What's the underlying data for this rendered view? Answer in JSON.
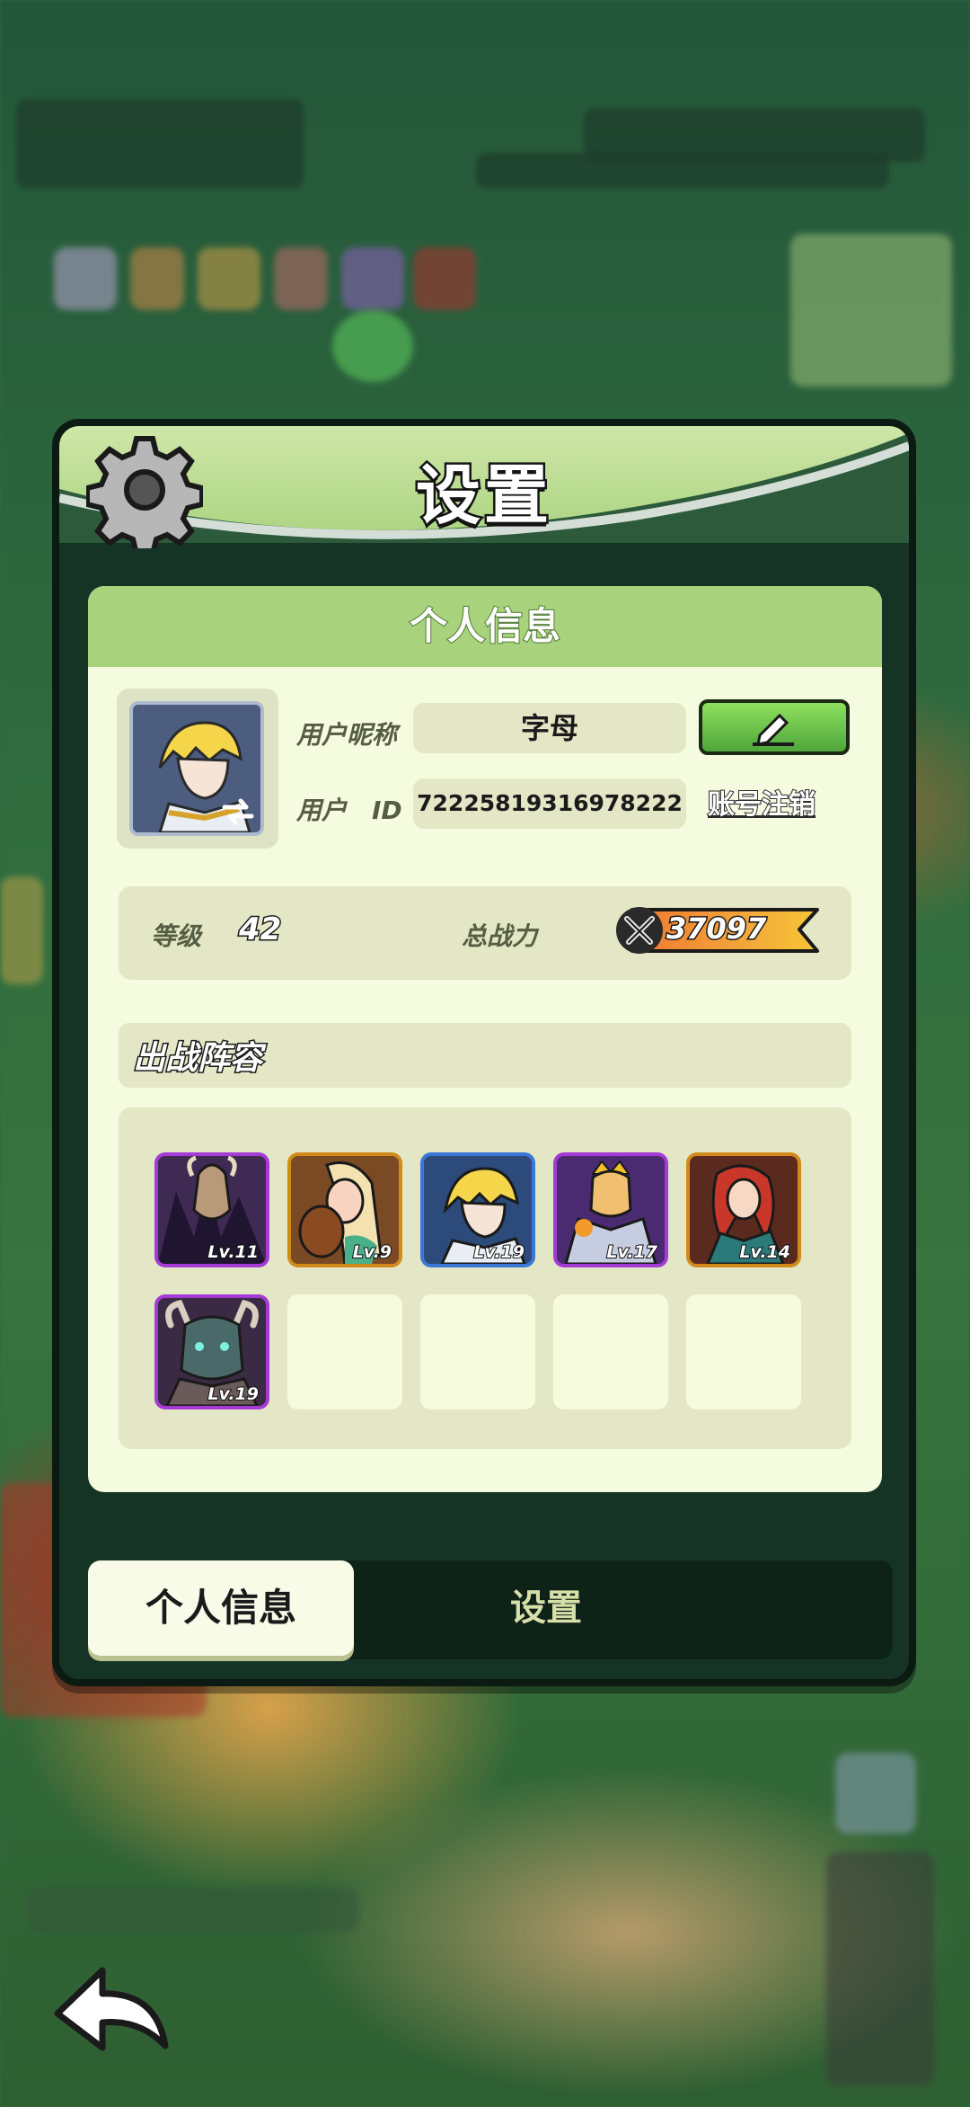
{
  "dialog": {
    "title": "设置",
    "card_title": "个人信息"
  },
  "profile": {
    "nickname_label": "用户昵称",
    "nickname": "字母",
    "id_label": "用户　ID",
    "user_id": "72225819316978222",
    "cancel_account": "账号注销"
  },
  "stats": {
    "level_label": "等级",
    "level": "42",
    "power_label": "总战力",
    "power": "37097"
  },
  "lineup": {
    "title": "出战阵容",
    "heroes": [
      {
        "level": "Lv.11",
        "rarity": "purple"
      },
      {
        "level": "Lv.9",
        "rarity": "orange"
      },
      {
        "level": "Lv.19",
        "rarity": "blue"
      },
      {
        "level": "Lv.17",
        "rarity": "purple"
      },
      {
        "level": "Lv.14",
        "rarity": "orange"
      },
      {
        "level": "Lv.19",
        "rarity": "purple"
      }
    ],
    "empty_slots": 4
  },
  "tabs": {
    "active": "个人信息",
    "inactive": "设置"
  },
  "colors": {
    "header_green": "#a9d37f",
    "card_bg": "#f5fbde",
    "button_green": "#4fa63a",
    "power_orange": "#f0772f",
    "power_yellow": "#f7c536"
  }
}
